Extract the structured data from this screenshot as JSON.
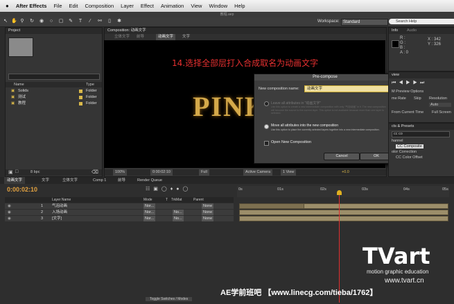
{
  "menubar": {
    "apple": "",
    "items": [
      "After Effects",
      "File",
      "Edit",
      "Composition",
      "Layer",
      "Effect",
      "Animation",
      "View",
      "Window",
      "Help"
    ]
  },
  "window_title": "教程.aep",
  "toolbar": {
    "workspace_label": "Workspace:",
    "workspace_value": "Standard",
    "search_placeholder": "Search Help"
  },
  "project": {
    "tab": "Project",
    "search_placeholder": "",
    "col_name": "Name",
    "col_type": "Type",
    "items": [
      {
        "name": "Solids",
        "type": "Folder"
      },
      {
        "name": "测试",
        "type": "Folder"
      },
      {
        "name": "教程",
        "type": "Folder"
      }
    ],
    "bpc": "8 bpc"
  },
  "comp": {
    "tab": "Composition: 动画文字",
    "breadcrumbs": [
      "立体文字",
      "前导",
      "动画文字",
      "文字"
    ],
    "instruction": "14.选择全部层打入合成取名为动画文字",
    "pink_text": "PINK",
    "zoom": "100%",
    "timecode": "0:00:02:10",
    "resolution": "Full",
    "camera": "Active Camera",
    "views": "1 View",
    "exposure": "+0.0"
  },
  "precompose": {
    "title": "Pre-compose",
    "name_label": "New composition name:",
    "name_value": "动画文字",
    "opt1": "Leave all attributes in \"动画文字\"",
    "opt1_desc": "Use this option to create a new intermediate composition with only \"气泡动画\" in it. The new composition will become the source to the current layer. This option is not available because more than one layer is selected.",
    "opt2": "Move all attributes into the new composition",
    "opt2_desc": "Use this option to place the currently selected layers together into a new intermediate composition.",
    "open_new": "Open New Composition",
    "cancel": "Cancel",
    "ok": "OK"
  },
  "info": {
    "tab_info": "Info",
    "tab_audio": "Audio",
    "r": "R :",
    "g": "G :",
    "b": "B :",
    "a": "A : 0",
    "x": "X : 342",
    "y": "Y : 326"
  },
  "preview": {
    "tab": "view",
    "ram": "M Preview Options",
    "frame_rate": "me Rate",
    "skip": "Skip",
    "resolution": "Resolution",
    "res_value": "Auto",
    "from_current": "From Current Time",
    "full_screen": "Full Screen"
  },
  "effects": {
    "tab": "cts & Presets",
    "search": "cc co",
    "items": [
      "hannel",
      "CC Composite",
      "olor Correction",
      "CC Color Offset"
    ]
  },
  "timeline": {
    "tabs": [
      "动画文字",
      "文字",
      "立体文字",
      "Comp 1",
      "前导",
      "Render Queue"
    ],
    "timecode": "0:00:02:10",
    "col_source": "Layer Name",
    "col_mode": "Mode",
    "col_t": "T",
    "col_trkmat": "TrkMat",
    "col_parent": "Parent",
    "layers": [
      {
        "num": "1",
        "name": "气泡动画",
        "mode": "Nor...",
        "trk": "",
        "parent": "None"
      },
      {
        "num": "2",
        "name": "入场动画",
        "mode": "Nor...",
        "trk": "No...",
        "parent": "None"
      },
      {
        "num": "3",
        "name": "[文字]",
        "mode": "Nor...",
        "trk": "No...",
        "parent": "None"
      }
    ],
    "ruler": [
      "0s",
      "01s",
      "02s",
      "03s",
      "04s",
      "05s"
    ],
    "toggle": "Toggle Switches / Modes"
  },
  "watermark": {
    "logo": "TVart",
    "tagline": "motion graphic education",
    "site": "www.tvart.cn",
    "footer": "AE学前班吧 【www.linecg.com/tieba/1762】"
  }
}
